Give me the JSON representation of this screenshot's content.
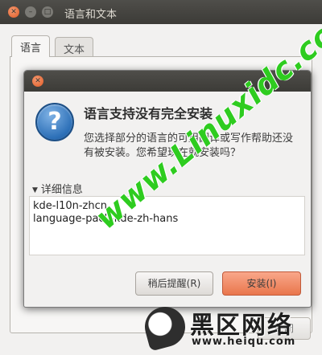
{
  "parent_window": {
    "title": "语言和文本",
    "tabs": [
      {
        "label": "语言",
        "active": true
      },
      {
        "label": "文本",
        "active": false
      }
    ],
    "close_button_label": "关闭"
  },
  "dialog": {
    "heading": "语言支持没有完全安装",
    "message": "您选择部分的语言的可用翻译或写作帮助还没有被安装。您希望现在就安装吗？",
    "details_label": "详细信息",
    "details_expanded": true,
    "packages": [
      "kde-l10n-zhcn",
      "language-pack-kde-zh-hans"
    ],
    "buttons": {
      "remind_label": "稍后提醒(R)",
      "install_label": "安装(I)"
    }
  },
  "watermark": {
    "diagonal_text": "www.Linuxidc.com",
    "logo_text": "黑区网络",
    "logo_url": "www.heiqu.com"
  },
  "colors": {
    "titlebar": "#3c3b37",
    "close_button": "#e05a25",
    "install_button": "#e9764c",
    "watermark_green": "#2ecc1f"
  },
  "icons": {
    "dialog_icon": "question-icon",
    "expander_icon": "triangle-down-icon",
    "close_icon": "close-icon"
  }
}
